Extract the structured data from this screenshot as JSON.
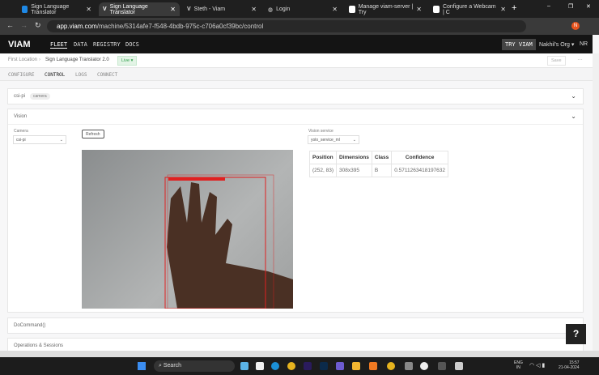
{
  "browser": {
    "tabs": [
      {
        "label": "Sign Language Translator",
        "active": false
      },
      {
        "label": "Sign Language Translator",
        "active": true
      },
      {
        "label": "Steth - Viam",
        "active": false
      },
      {
        "label": "Login",
        "active": false
      },
      {
        "label": "Manage viam-server | Try",
        "active": false
      },
      {
        "label": "Configure a Webcam | C",
        "active": false
      }
    ],
    "url_host": "app.viam.com",
    "url_path": "/machine/5314afe7-f548-4bdb-975c-c706a0cf39bc/control",
    "profile_initial": "N"
  },
  "nav": {
    "logo": "VIAM",
    "items": [
      "FLEET",
      "DATA",
      "REGISTRY",
      "DOCS"
    ],
    "try": "TRY VIAM",
    "org": "Nakhil's Org",
    "user": "NR"
  },
  "breadcrumb": {
    "location": "First Location",
    "machine": "Sign Language Translator 2.0",
    "status": "Live",
    "save": "Save"
  },
  "subtabs": [
    "CONFIGURE",
    "CONTROL",
    "LOGS",
    "CONNECT"
  ],
  "cards": {
    "camera": {
      "name": "csi-pi",
      "badge": "camera"
    },
    "vision": {
      "title": "Vision",
      "camera_label": "Camera",
      "camera_value": "csi-pi",
      "refresh": "Refresh",
      "service_label": "Vision service",
      "service_value": "yolo_service_ml"
    },
    "docommand": "DoCommand()",
    "ops": "Operations & Sessions"
  },
  "detections": {
    "headers": [
      "Position",
      "Dimensions",
      "Class",
      "Confidence"
    ],
    "rows": [
      [
        "(252, 83)",
        "308x395",
        "B",
        "0.5711263418197632"
      ]
    ]
  },
  "taskbar": {
    "search": "Search",
    "lang": "ENG",
    "region": "IN",
    "time": "15:57",
    "date": "21-04-2024"
  },
  "colors": {
    "bbox": "#e02020",
    "live": "#2e9e4a"
  }
}
